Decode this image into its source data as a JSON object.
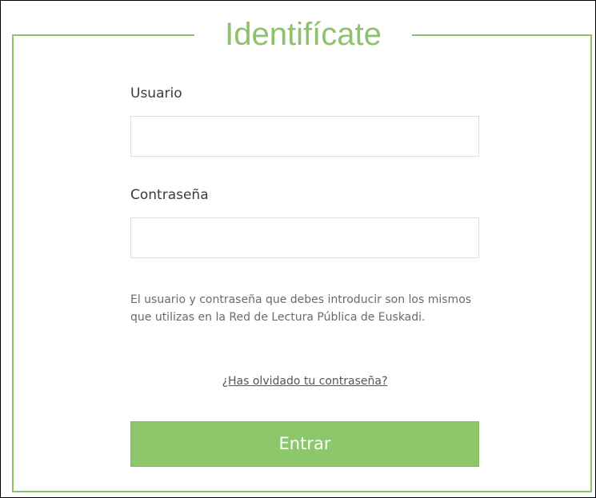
{
  "login": {
    "title": "Identifícate",
    "username_label": "Usuario",
    "username_value": "",
    "password_label": "Contraseña",
    "password_value": "",
    "help_text": "El usuario y contraseña que debes introducir son los mismos que utilizas en la Red de Lectura Pública de Euskadi.",
    "forgot_link": "¿Has olvidado tu contraseña?",
    "submit_label": "Entrar"
  },
  "colors": {
    "accent": "#8cc36a",
    "button": "#8cc76c",
    "input_border": "#dedede"
  }
}
